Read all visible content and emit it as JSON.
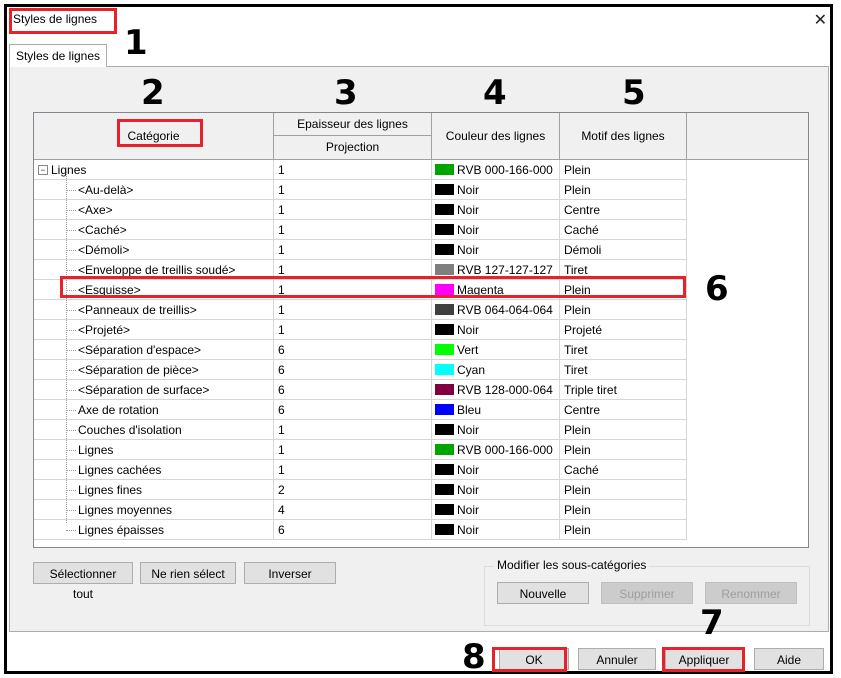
{
  "window": {
    "title": "Styles de lignes",
    "close_icon": "close-icon"
  },
  "tab": {
    "label": "Styles de lignes"
  },
  "columns": {
    "category": "Catégorie",
    "thickness": "Epaisseur des lignes",
    "thickness_sub": "Projection",
    "color": "Couleur des lignes",
    "pattern": "Motif des lignes"
  },
  "rows": [
    {
      "name": "Lignes",
      "thickness": "1",
      "color_label": "RVB 000-166-000",
      "color": "#00a600",
      "pattern": "Plein"
    },
    {
      "name": "<Au-delà>",
      "thickness": "1",
      "color_label": "Noir",
      "color": "#000000",
      "pattern": "Plein"
    },
    {
      "name": "<Axe>",
      "thickness": "1",
      "color_label": "Noir",
      "color": "#000000",
      "pattern": "Centre"
    },
    {
      "name": "<Caché>",
      "thickness": "1",
      "color_label": "Noir",
      "color": "#000000",
      "pattern": "Caché"
    },
    {
      "name": "<Démoli>",
      "thickness": "1",
      "color_label": "Noir",
      "color": "#000000",
      "pattern": "Démoli"
    },
    {
      "name": "<Enveloppe de treillis soudé>",
      "thickness": "1",
      "color_label": "RVB 127-127-127",
      "color": "#7f7f7f",
      "pattern": "Tiret"
    },
    {
      "name": "<Esquisse>",
      "thickness": "1",
      "color_label": "Magenta",
      "color": "#ff00ff",
      "pattern": "Plein"
    },
    {
      "name": "<Panneaux de treillis>",
      "thickness": "1",
      "color_label": "RVB 064-064-064",
      "color": "#404040",
      "pattern": "Plein"
    },
    {
      "name": "<Projeté>",
      "thickness": "1",
      "color_label": "Noir",
      "color": "#000000",
      "pattern": "Projeté"
    },
    {
      "name": "<Séparation d'espace>",
      "thickness": "6",
      "color_label": "Vert",
      "color": "#00ff00",
      "pattern": "Tiret"
    },
    {
      "name": "<Séparation de pièce>",
      "thickness": "6",
      "color_label": "Cyan",
      "color": "#00ffff",
      "pattern": "Tiret"
    },
    {
      "name": "<Séparation de surface>",
      "thickness": "6",
      "color_label": "RVB 128-000-064",
      "color": "#800040",
      "pattern": "Triple tiret"
    },
    {
      "name": "Axe de rotation",
      "thickness": "6",
      "color_label": "Bleu",
      "color": "#0000ff",
      "pattern": "Centre"
    },
    {
      "name": "Couches d'isolation",
      "thickness": "1",
      "color_label": "Noir",
      "color": "#000000",
      "pattern": "Plein"
    },
    {
      "name": "Lignes",
      "thickness": "1",
      "color_label": "RVB 000-166-000",
      "color": "#00a600",
      "pattern": "Plein"
    },
    {
      "name": "Lignes cachées",
      "thickness": "1",
      "color_label": "Noir",
      "color": "#000000",
      "pattern": "Caché"
    },
    {
      "name": "Lignes fines",
      "thickness": "2",
      "color_label": "Noir",
      "color": "#000000",
      "pattern": "Plein"
    },
    {
      "name": "Lignes moyennes",
      "thickness": "4",
      "color_label": "Noir",
      "color": "#000000",
      "pattern": "Plein"
    },
    {
      "name": "Lignes épaisses",
      "thickness": "6",
      "color_label": "Noir",
      "color": "#000000",
      "pattern": "Plein"
    }
  ],
  "buttons": {
    "select_all": "Sélectionner tout",
    "select_none": "Ne rien sélect",
    "invert": "Inverser",
    "subcat_group": "Modifier les sous-catégories",
    "new": "Nouvelle",
    "delete": "Supprimer",
    "rename": "Renommer",
    "ok": "OK",
    "cancel": "Annuler",
    "apply": "Appliquer",
    "help": "Aide"
  },
  "callouts": [
    "1",
    "2",
    "3",
    "4",
    "5",
    "6",
    "7",
    "8"
  ],
  "highlight_color": "#e8222b"
}
